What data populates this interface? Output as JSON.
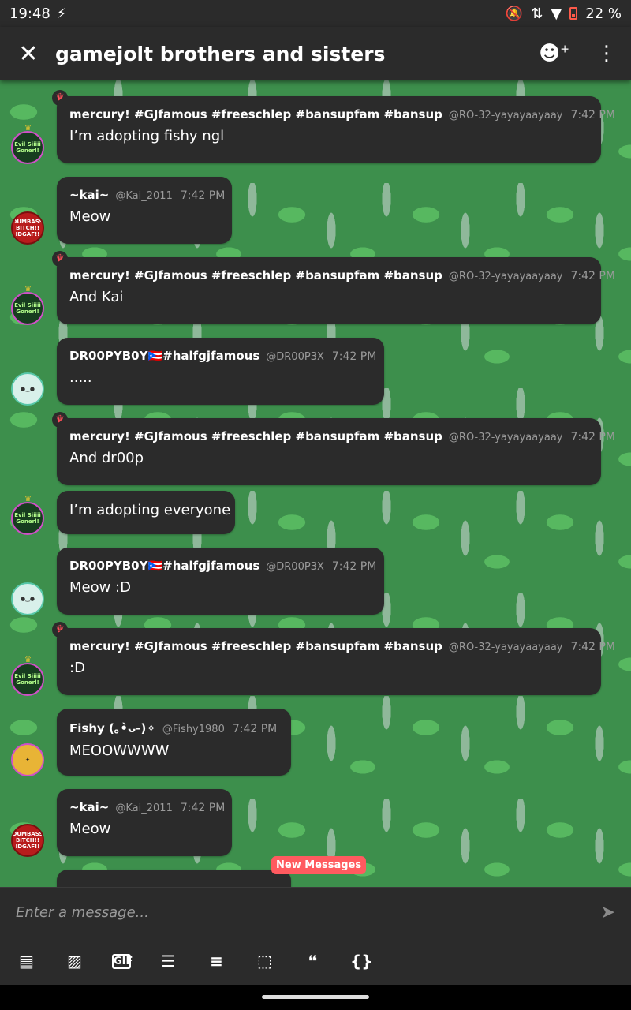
{
  "status": {
    "time": "19:48",
    "battery": "22 %"
  },
  "header": {
    "title": "gamejolt brothers and sisters"
  },
  "messages": [
    {
      "name": "mercury!  #GJfamous #freeschlep #bansupfam #bansup",
      "handle": "@RO-32-yayayaayaay",
      "time": "7:42 PM",
      "text": "I’m adopting fishy ngl"
    },
    {
      "name": "~kai~",
      "handle": "@Kai_2011",
      "time": "7:42 PM",
      "text": "Meow"
    },
    {
      "name": "mercury!  #GJfamous #freeschlep #bansupfam #bansup",
      "handle": "@RO-32-yayayaayaay",
      "time": "7:42 PM",
      "text": "And Kai"
    },
    {
      "name": "DR00PYB0Y🇵🇷#halfgjfamous",
      "handle": "@DR00P3X",
      "time": "7:42 PM",
      "text": "....."
    },
    {
      "name": "mercury!  #GJfamous #freeschlep #bansupfam #bansup",
      "handle": "@RO-32-yayayaayaay",
      "time": "7:42 PM",
      "text": "And dr00p"
    },
    {
      "text": "I’m adopting everyone"
    },
    {
      "name": "DR00PYB0Y🇵🇷#halfgjfamous",
      "handle": "@DR00P3X",
      "time": "7:42 PM",
      "text": "Meow :D"
    },
    {
      "name": "mercury!  #GJfamous #freeschlep #bansupfam #bansup",
      "handle": "@RO-32-yayayaayaay",
      "time": "7:42 PM",
      "text": ":D"
    },
    {
      "name": "Fishy (｡•̀ᴗ-)✧",
      "handle": "@Fishy1980",
      "time": "7:42 PM",
      "text": "MEOOWWWW"
    },
    {
      "name": "~kai~",
      "handle": "@Kai_2011",
      "time": "7:42 PM",
      "text": "Meow"
    }
  ],
  "avatars": {
    "evil": "Evil Siiiii Gonerl!",
    "dumb": "DUMBASS BITCH!! IDGAF!!"
  },
  "new_messages_label": "New Messages",
  "composer": {
    "placeholder": "Enter a message..."
  },
  "toolbar": {
    "gif": "GIF",
    "quote": "❝",
    "code": "{}"
  },
  "colors": {
    "bubble": "#2b2b2b",
    "background": "#3d8f4c",
    "badge": "#ff5a5f",
    "owner_crown": "#ff4f5a"
  }
}
